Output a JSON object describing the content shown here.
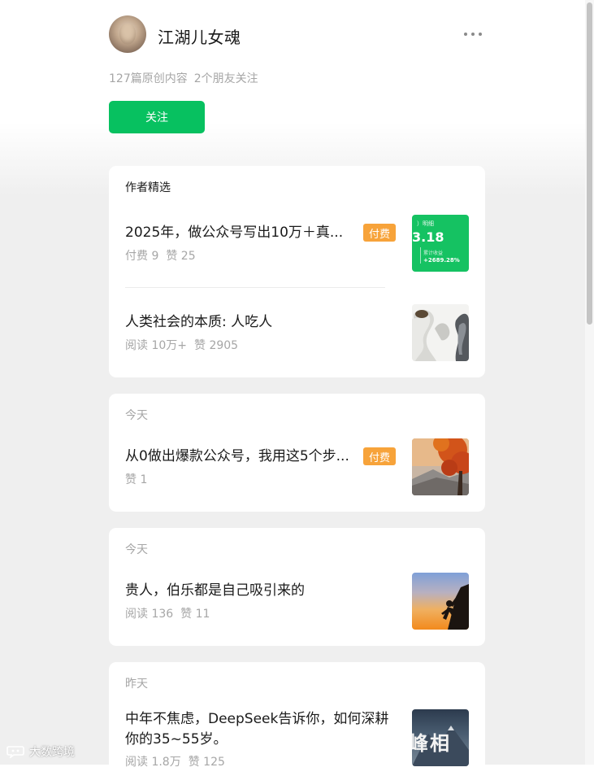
{
  "profile": {
    "name": "江湖儿女魂",
    "stats": {
      "original": "127篇原创内容",
      "friends": "2个朋友关注"
    },
    "follow_label": "关注"
  },
  "featured": {
    "label": "作者精选",
    "articles": [
      {
        "title": "2025年，做公众号写出10万＋真...",
        "paid_badge": "付费",
        "meta": [
          "付费 9",
          "赞 25"
        ],
        "thumb": {
          "name": "income-screenshot",
          "line1": "）明细",
          "line2": "3.18",
          "line3": "累计收益",
          "line4": "+2689.28%"
        }
      },
      {
        "title": "人类社会的本质: 人吃人",
        "meta": [
          "阅读 10万+",
          "赞 2905"
        ],
        "thumb": {
          "name": "sculpture-photo"
        }
      }
    ]
  },
  "feed": [
    {
      "date": "今天",
      "title": "从0做出爆款公众号，我用这5个步...",
      "paid_badge": "付费",
      "meta": [
        "赞 1"
      ],
      "thumb": {
        "name": "autumn-tree-photo"
      }
    },
    {
      "date": "今天",
      "title": "贵人，伯乐都是自己吸引来的",
      "meta": [
        "阅读 136",
        "赞 11"
      ],
      "thumb": {
        "name": "climber-silhouette-photo"
      }
    },
    {
      "date": "昨天",
      "title": "中年不焦虑，DeepSeek告诉你，如何深耕你的35~55岁。",
      "meta": [
        "阅读 1.8万",
        "赞 125"
      ],
      "thumb": {
        "name": "mountain-text-photo",
        "text": "峰相"
      }
    }
  ],
  "watermark": {
    "text": "大数跨境",
    "icon": "speech-bubble-logo"
  },
  "colors": {
    "accent": "#07c160",
    "paid": "#f7a33a",
    "muted": "#a6a6a6"
  }
}
